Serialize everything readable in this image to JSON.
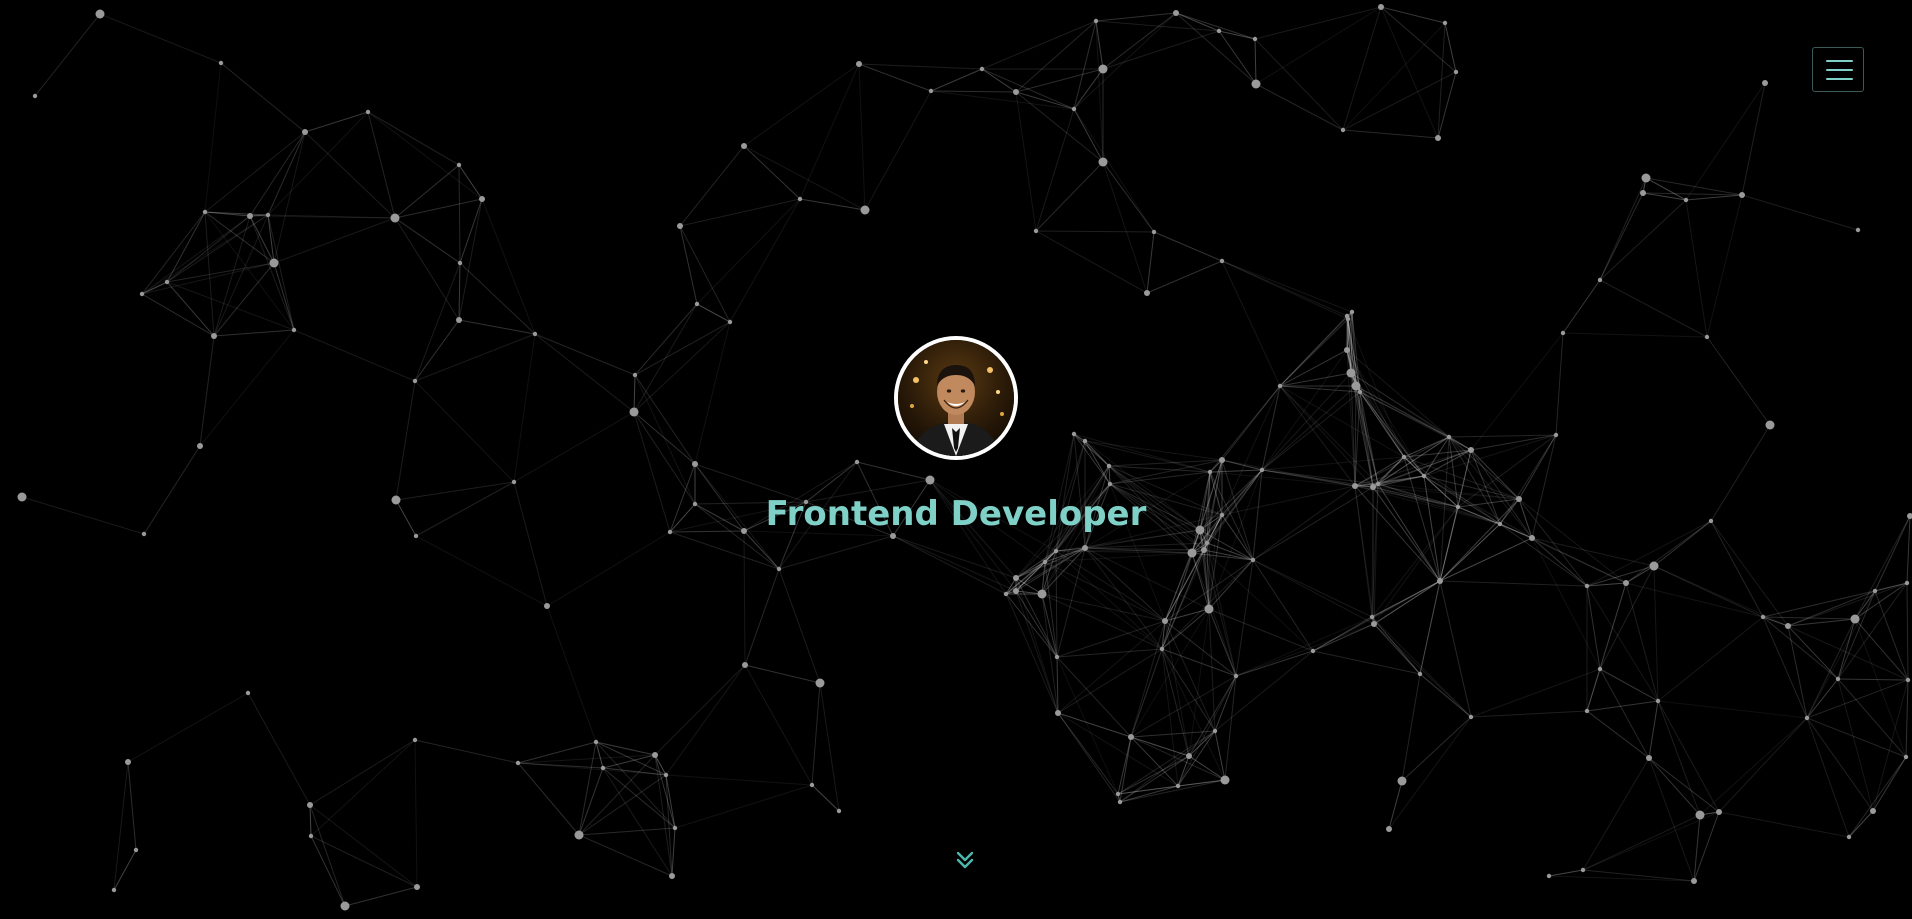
{
  "hero": {
    "headline": "Frontend Developer"
  },
  "navigation": {
    "menu_button": {
      "icon": "hamburger-icon"
    }
  },
  "scroll_indicator": {
    "icon": "double-chevron-down-icon"
  },
  "avatar": {
    "kind": "profile-photo"
  },
  "colors": {
    "background": "#000000",
    "accent": "#7fd1c8",
    "network_line": "#ffffff",
    "network_node": "#9a9a9a",
    "avatar_border": "#ffffff"
  }
}
